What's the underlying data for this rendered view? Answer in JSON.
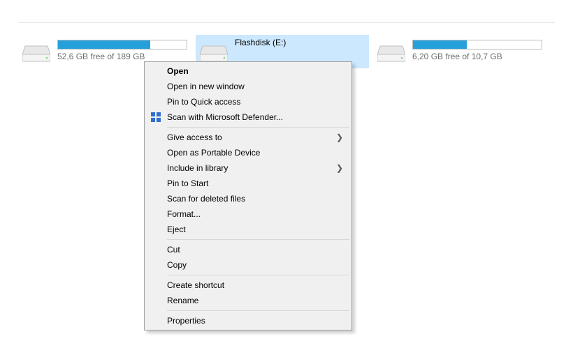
{
  "drives": [
    {
      "label": "",
      "subtext": "52,6 GB free of 189 GB",
      "fill_pct": 72,
      "selected": false
    },
    {
      "label": "Flashdisk (E:)",
      "subtext": "",
      "fill_pct": 0,
      "selected": true
    },
    {
      "label": "",
      "subtext": "6,20 GB free of 10,7 GB",
      "fill_pct": 42,
      "selected": false
    }
  ],
  "menu": {
    "open": "Open",
    "open_new_window": "Open in new window",
    "pin_quick_access": "Pin to Quick access",
    "scan_defender": "Scan with Microsoft Defender...",
    "give_access_to": "Give access to",
    "open_portable": "Open as Portable Device",
    "include_in_library": "Include in library",
    "pin_to_start": "Pin to Start",
    "scan_deleted": "Scan for deleted files",
    "format": "Format...",
    "eject": "Eject",
    "cut": "Cut",
    "copy": "Copy",
    "create_shortcut": "Create shortcut",
    "rename": "Rename",
    "properties": "Properties"
  }
}
